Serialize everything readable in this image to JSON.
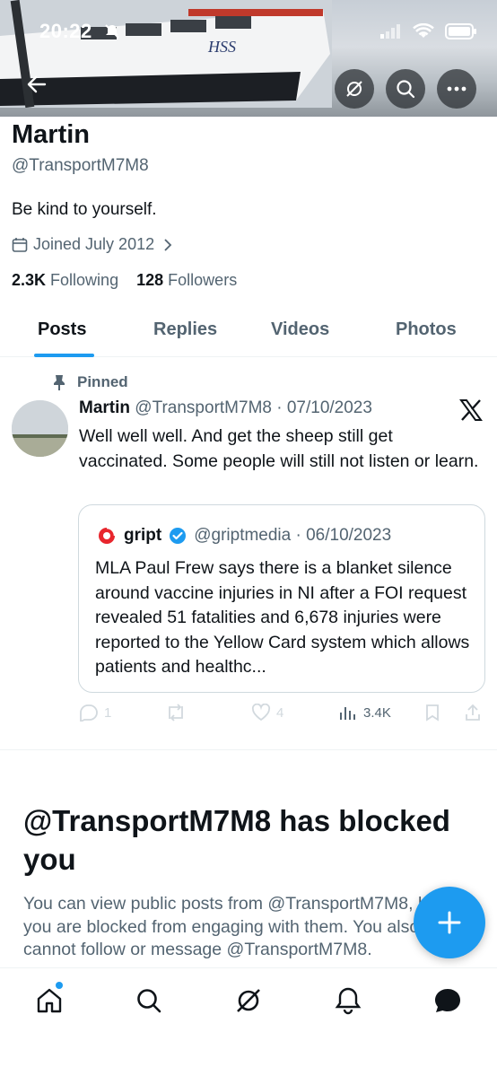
{
  "status_bar": {
    "time": "20:22"
  },
  "banner": {
    "ship_text": "HSS"
  },
  "profile": {
    "name": "Martin",
    "handle": "@TransportM7M8",
    "bio": "Be kind to yourself.",
    "joined": "Joined July 2012",
    "following_count": "2.3K",
    "following_label": "Following",
    "followers_count": "128",
    "followers_label": "Followers"
  },
  "tabs": [
    {
      "label": "Posts",
      "active": true
    },
    {
      "label": "Replies"
    },
    {
      "label": "Videos"
    },
    {
      "label": "Photos"
    }
  ],
  "tweet": {
    "pinned_label": "Pinned",
    "author": "Martin",
    "handle_date": "@TransportM7M8 · 07/10/2023",
    "text": "Well well well. And get the sheep still get vaccinated. Some people will still not listen or learn.",
    "quote": {
      "author": "gript",
      "handle_date": "@griptmedia · 06/10/2023",
      "text": "MLA Paul Frew says there is a blanket silence around vaccine injuries in NI after a FOI request revealed 51 fatalities and 6,678 injuries were reported to the Yellow Card system which allows patients and healthc..."
    },
    "actions": {
      "replies": "1",
      "likes": "4",
      "views": "3.4K"
    }
  },
  "blocked": {
    "title": "@TransportM7M8 has blocked you",
    "body": "You can view public posts from @TransportM7M8, but you are blocked from engaging with them. You also cannot follow or message @TransportM7M8."
  },
  "colors": {
    "accent": "#1d9bf0",
    "text": "#0f1419",
    "muted": "#536471",
    "gript": "#e8262d"
  },
  "icons": [
    "back-icon",
    "grok-icon",
    "search-icon",
    "more-icon",
    "calendar-icon",
    "chevron-right-icon",
    "pin-icon",
    "x-logo-icon",
    "verified-icon",
    "reply-icon",
    "repost-icon",
    "like-icon",
    "views-icon",
    "bookmark-icon",
    "share-icon",
    "compose-icon",
    "home-icon",
    "notifications-icon",
    "messages-icon"
  ]
}
